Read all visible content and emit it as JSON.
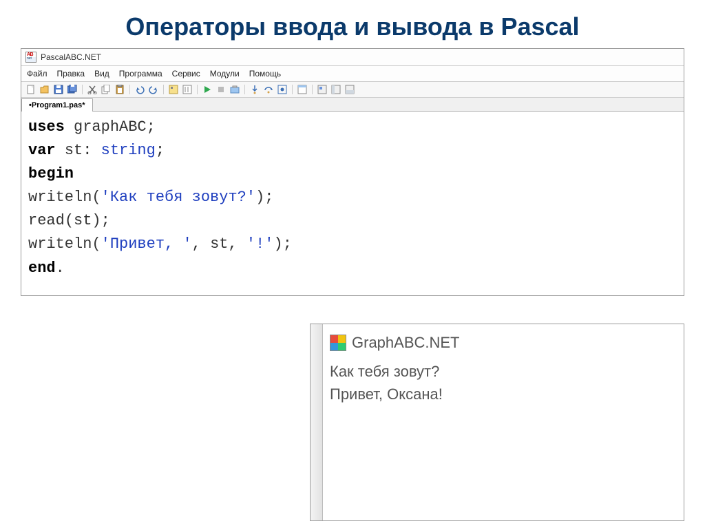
{
  "slide": {
    "title": "Операторы ввода и вывода в Pascal"
  },
  "app": {
    "title": "PascalABC.NET"
  },
  "menu": {
    "file": "Файл",
    "edit": "Правка",
    "view": "Вид",
    "program": "Программа",
    "service": "Сервис",
    "modules": "Модули",
    "help": "Помощь"
  },
  "tab": {
    "name": "•Program1.pas*"
  },
  "code": {
    "uses": "uses",
    "graphabc": "graphABC",
    "var": "var",
    "st": "st",
    "colon": ":",
    "string": "string",
    "semicolon": ";",
    "begin": "begin",
    "writeln1_fn": "writeln",
    "lparen": "(",
    "rparen": ")",
    "str1": "'Как тебя зовут?'",
    "read_fn": "read",
    "st_arg": "st",
    "writeln2_fn": "writeln",
    "str2a": "'Привет, '",
    "comma": ",",
    "st_arg2": "st",
    "str2b": "'!'",
    "end": "end",
    "dot": "."
  },
  "output": {
    "title": "GraphABC.NET",
    "line1": "Как тебя зовут?",
    "line2": "Привет, Оксана!"
  }
}
